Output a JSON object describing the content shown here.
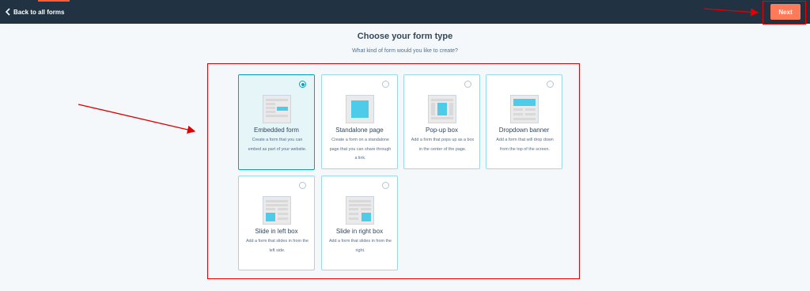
{
  "topbar": {
    "back_label": "Back to all forms",
    "next_label": "Next"
  },
  "page": {
    "heading": "Choose your form type",
    "subheading": "What kind of form would you like to create?"
  },
  "form_types": [
    {
      "title": "Embedded form",
      "description": "Create a form that you can embed as part of your website.",
      "selected": true
    },
    {
      "title": "Standalone page",
      "description": "Create a form on a standalone page that you can share through a link.",
      "selected": false
    },
    {
      "title": "Pop-up box",
      "description": "Add a form that pops up as a box in the center of the page.",
      "selected": false
    },
    {
      "title": "Dropdown banner",
      "description": "Add a form that will drop down from the top of the screen.",
      "selected": false
    },
    {
      "title": "Slide in left box",
      "description": "Add a form that slides in from the left side.",
      "selected": false
    },
    {
      "title": "Slide in right box",
      "description": "Add a form that slides in from the right.",
      "selected": false
    }
  ],
  "colors": {
    "topbar": "#213343",
    "next_button": "#ff7a59",
    "selected_border": "#00a4bd",
    "thumbnail_accent": "#4fcbea",
    "annotation": "#e00000"
  }
}
